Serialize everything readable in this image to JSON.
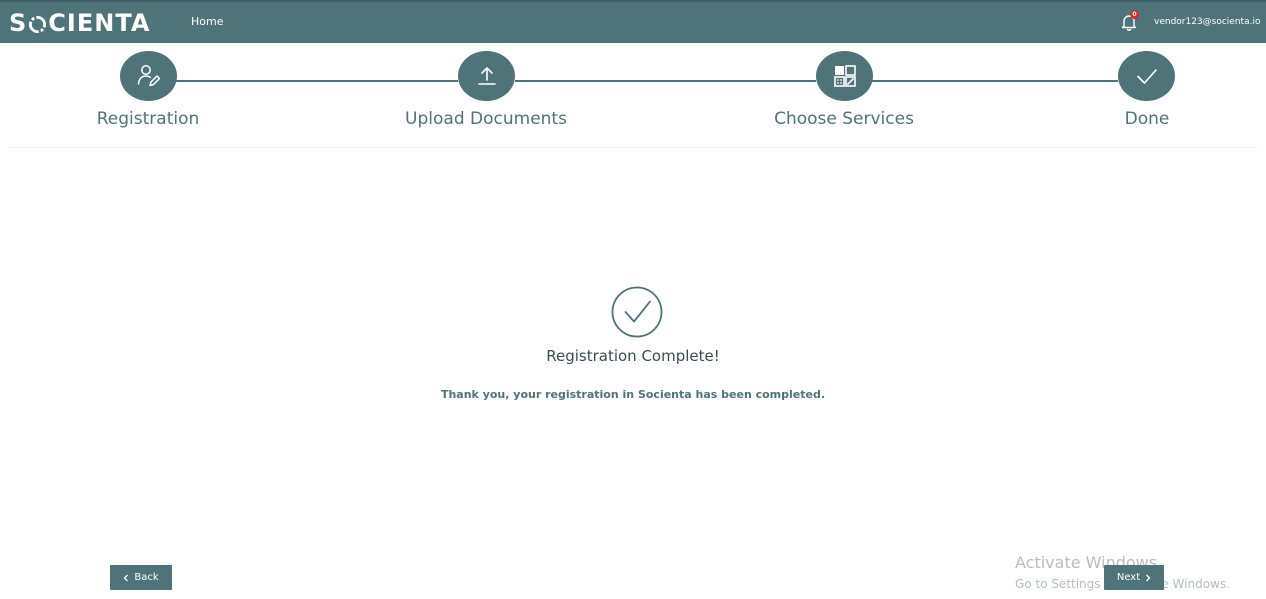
{
  "header": {
    "logo_text_left": "S",
    "logo_text_right": "CIENTA",
    "logo_alt": "SOCIENTA",
    "nav_home": "Home",
    "notification_count": "0",
    "user_email": "vendor123@socienta.io"
  },
  "stepper": {
    "steps": [
      {
        "label": "Registration",
        "icon": "user-edit-icon"
      },
      {
        "label": "Upload Documents",
        "icon": "upload-icon"
      },
      {
        "label": "Choose Services",
        "icon": "services-grid-icon"
      },
      {
        "label": "Done",
        "icon": "checkmark-icon"
      }
    ]
  },
  "main": {
    "title": "Registration Complete!",
    "message": "Thank you, your registration in Socienta has been completed."
  },
  "footer": {
    "back_label": "Back",
    "next_label": "Next"
  },
  "watermark": {
    "title": "Activate Windows",
    "subtitle": "Go to Settings to activate Windows."
  },
  "colors": {
    "brand": "#4e7479",
    "badge": "#e0262f"
  }
}
